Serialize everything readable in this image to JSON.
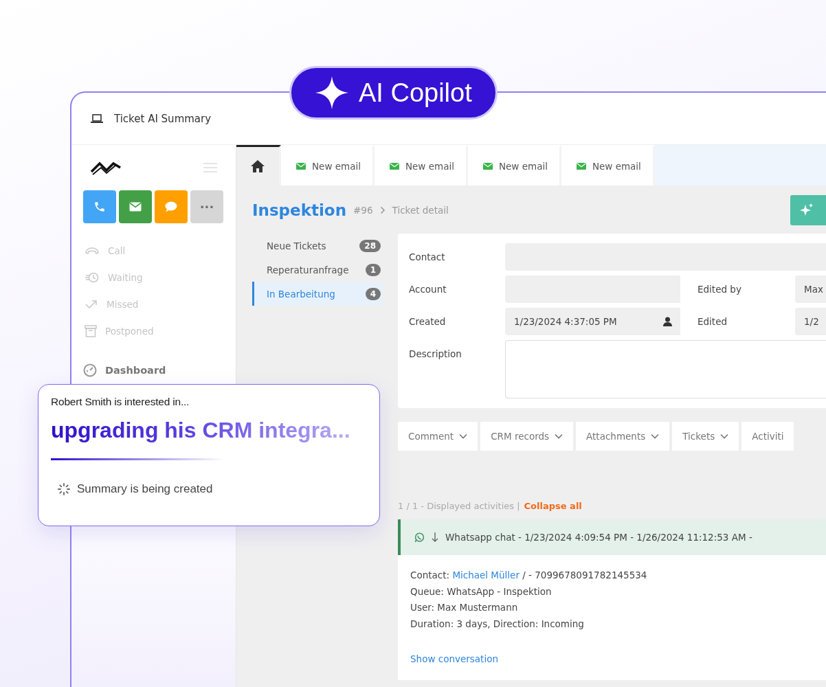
{
  "badge": {
    "label": "AI Copilot"
  },
  "window": {
    "title": "Ticket AI Summary"
  },
  "sidebar": {
    "quick_actions": [
      {
        "kind": "phone",
        "color": "#42a5f5"
      },
      {
        "kind": "email",
        "color": "#43a047"
      },
      {
        "kind": "chat",
        "color": "#ffa000"
      },
      {
        "kind": "more",
        "color": "#d6d6d6",
        "label": "···"
      }
    ],
    "items": [
      {
        "kind": "call",
        "label": "Call"
      },
      {
        "kind": "waiting",
        "label": "Waiting"
      },
      {
        "kind": "missed",
        "label": "Missed"
      },
      {
        "kind": "postponed",
        "label": "Postponed"
      }
    ],
    "dashboard": {
      "label": "Dashboard"
    }
  },
  "tabs": [
    {
      "kind": "home",
      "selected": true
    },
    {
      "kind": "email",
      "label": "New email",
      "selected": false
    },
    {
      "kind": "email",
      "label": "New email",
      "selected": false
    },
    {
      "kind": "email",
      "label": "New email",
      "selected": false
    },
    {
      "kind": "email",
      "label": "New email",
      "selected": false
    }
  ],
  "header": {
    "title": "Inspektion",
    "number": "#96",
    "crumb": "Ticket detail"
  },
  "queues": [
    {
      "label": "Neue Tickets",
      "count": "28",
      "selected": false
    },
    {
      "label": "Reperaturanfrage",
      "count": "1",
      "selected": false
    },
    {
      "label": "In Bearbeitung",
      "count": "4",
      "selected": true
    }
  ],
  "form": {
    "contact": {
      "label": "Contact"
    },
    "account": {
      "label": "Account"
    },
    "edited_by": {
      "label": "Edited by",
      "value": "Max"
    },
    "created": {
      "label": "Created",
      "value": "1/23/2024 4:37:05 PM"
    },
    "edited": {
      "label": "Edited",
      "value": "1/2"
    },
    "description": {
      "label": "Description"
    }
  },
  "activity_tabs": [
    {
      "label": "Comment",
      "dropdown": true
    },
    {
      "label": "CRM records",
      "dropdown": true
    },
    {
      "label": "Attachments",
      "dropdown": true
    },
    {
      "label": "Tickets",
      "dropdown": true
    },
    {
      "label": "Activiti",
      "dropdown": false
    }
  ],
  "activities": {
    "summary": "1 / 1 - Displayed activities |",
    "collapse": "Collapse all",
    "items": [
      {
        "header": "Whatsapp chat - 1/23/2024 4:09:54 PM - 1/26/2024 11:12:53 AM -",
        "contact_label": "Contact:",
        "contact_name": "Michael Müller",
        "contact_rest": "/ - 7099678091782145534",
        "lines": [
          "Queue: WhatsApp - Inspektion",
          "User: Max Mustermann",
          "Duration: 3 days, Direction: Incoming"
        ],
        "link": "Show conversation"
      }
    ]
  },
  "popup": {
    "intro": "Robert Smith is interested in...",
    "headline": "upgrading his CRM integra...",
    "status": "Summary is being created"
  }
}
